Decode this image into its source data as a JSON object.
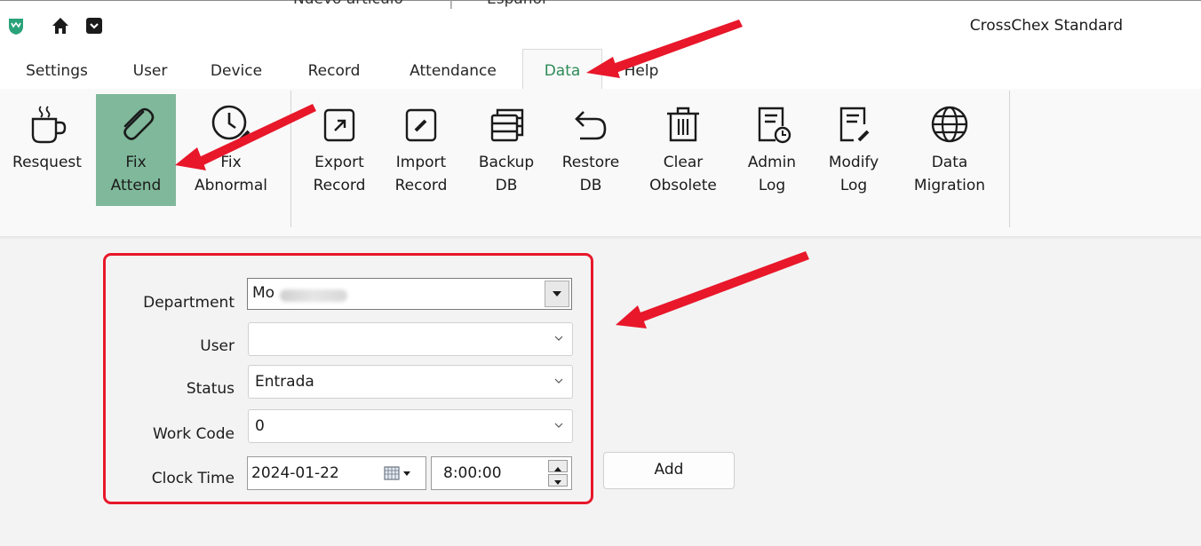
{
  "window": {
    "cut_text_left": "Nuevo artículo",
    "cut_text_right": "Español",
    "app_title": "CrossChex Standard"
  },
  "tabs": [
    {
      "label": "Settings"
    },
    {
      "label": "User"
    },
    {
      "label": "Device"
    },
    {
      "label": "Record"
    },
    {
      "label": "Attendance"
    },
    {
      "label": "Data",
      "active": true
    },
    {
      "label": "Help"
    }
  ],
  "ribbon": [
    {
      "line1": "Resquest",
      "line2": "",
      "icon": "coffee-icon"
    },
    {
      "line1": "Fix",
      "line2": "Attend",
      "icon": "paperclip-icon",
      "selected": true
    },
    {
      "line1": "Fix",
      "line2": "Abnormal",
      "icon": "clock-edit-icon"
    },
    {
      "line1": "Export",
      "line2": "Record",
      "icon": "export-icon"
    },
    {
      "line1": "Import",
      "line2": "Record",
      "icon": "import-icon"
    },
    {
      "line1": "Backup",
      "line2": "DB",
      "icon": "database-icon"
    },
    {
      "line1": "Restore",
      "line2": "DB",
      "icon": "undo-icon"
    },
    {
      "line1": "Clear",
      "line2": "Obsolete",
      "icon": "trash-icon"
    },
    {
      "line1": "Admin",
      "line2": "Log",
      "icon": "log-clock-icon"
    },
    {
      "line1": "Modify",
      "line2": "Log",
      "icon": "log-edit-icon"
    },
    {
      "line1": "Data",
      "line2": "Migration",
      "icon": "globe-icon"
    }
  ],
  "form": {
    "department_label": "Department",
    "department_value": "Mo",
    "user_label": "User",
    "user_value": "",
    "status_label": "Status",
    "status_value": "Entrada",
    "workcode_label": "Work Code",
    "workcode_value": "0",
    "clocktime_label": "Clock Time",
    "date_value": "2024-01-22",
    "time_value": "8:00:00",
    "add_label": "Add"
  },
  "colors": {
    "active_tab_text": "#2e8b57",
    "selected_button_bg": "#7fb89a",
    "annotation_red": "#e8172a"
  }
}
